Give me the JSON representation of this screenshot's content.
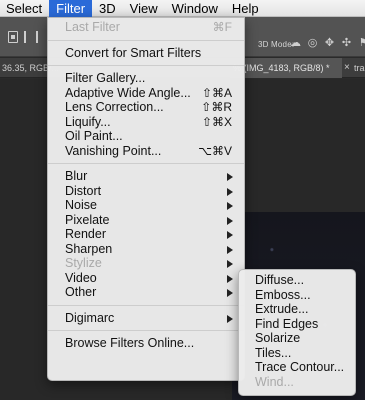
{
  "menubar": {
    "items": [
      {
        "label": "Select"
      },
      {
        "label": "Filter",
        "active": true
      },
      {
        "label": "3D"
      },
      {
        "label": "View"
      },
      {
        "label": "Window"
      },
      {
        "label": "Help"
      }
    ]
  },
  "options_bar": {
    "mode_3d_label": "3D Mode:"
  },
  "tabs": {
    "left_fragment": "36.35, RGB/...",
    "active_title": "% (IMG_4183, RGB/8) *",
    "close_glyph": "×",
    "right_fragment": "tra"
  },
  "filter_menu": {
    "last_filter": {
      "label": "Last Filter",
      "shortcut": "⌘F"
    },
    "convert": {
      "label": "Convert for Smart Filters"
    },
    "group1": [
      {
        "label": "Filter Gallery...",
        "shortcut": ""
      },
      {
        "label": "Adaptive Wide Angle...",
        "shortcut": "⇧⌘A"
      },
      {
        "label": "Lens Correction...",
        "shortcut": "⇧⌘R"
      },
      {
        "label": "Liquify...",
        "shortcut": "⇧⌘X"
      },
      {
        "label": "Oil Paint...",
        "shortcut": ""
      },
      {
        "label": "Vanishing Point...",
        "shortcut": "⌥⌘V"
      }
    ],
    "submenus": [
      {
        "label": "Blur"
      },
      {
        "label": "Distort"
      },
      {
        "label": "Noise"
      },
      {
        "label": "Pixelate"
      },
      {
        "label": "Render"
      },
      {
        "label": "Sharpen"
      },
      {
        "label": "Stylize"
      },
      {
        "label": "Video"
      },
      {
        "label": "Other"
      }
    ],
    "digimarc": {
      "label": "Digimarc"
    },
    "browse": {
      "label": "Browse Filters Online..."
    }
  },
  "stylize_submenu": {
    "items": [
      {
        "label": "Diffuse..."
      },
      {
        "label": "Emboss..."
      },
      {
        "label": "Extrude..."
      },
      {
        "label": "Find Edges"
      },
      {
        "label": "Solarize"
      },
      {
        "label": "Tiles..."
      },
      {
        "label": "Trace Contour..."
      },
      {
        "label": "Wind..."
      }
    ]
  }
}
